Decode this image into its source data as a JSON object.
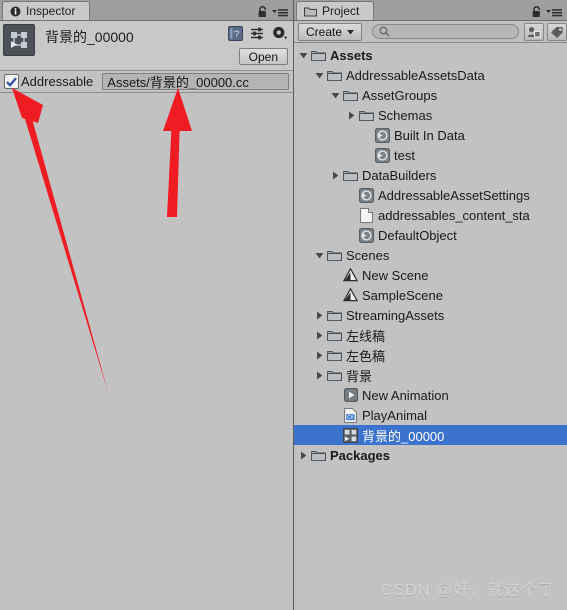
{
  "inspector": {
    "tab_label": "Inspector",
    "tab_icon": "info-icon",
    "lock_icon": "lock-icon",
    "menu_icon": "hamburger-menu-icon",
    "asset_icon": "animator-controller-icon",
    "asset_name": "背景的_00000",
    "help_icon": "help-book-icon",
    "preset_icon": "preset-sliders-icon",
    "settings_icon": "gear-icon",
    "open_button": "Open",
    "addressable": {
      "checked": true,
      "checkbox_icon": "checkmark-icon",
      "label": "Addressable",
      "address_value": "Assets/背景的_00000.cc",
      "address_placeholder": "Address"
    }
  },
  "project": {
    "tab_label": "Project",
    "tab_icon": "folder-icon",
    "lock_icon": "lock-icon",
    "menu_icon": "hamburger-menu-icon",
    "toolbar": {
      "create_label": "Create",
      "create_caret_icon": "chevron-down-icon",
      "search_icon": "search-icon",
      "search_value": "",
      "search_placeholder": "",
      "filter_type_icon": "filter-by-type-icon",
      "filter_label_icon": "filter-by-label-icon"
    },
    "tree": [
      {
        "label": "Assets",
        "depth": 0,
        "icon": "folder-icon",
        "toggle": "expanded",
        "bold": true,
        "selected": false
      },
      {
        "label": "AddressableAssetsData",
        "depth": 1,
        "icon": "folder-icon",
        "toggle": "expanded",
        "bold": false,
        "selected": false
      },
      {
        "label": "AssetGroups",
        "depth": 2,
        "icon": "folder-icon",
        "toggle": "expanded",
        "bold": false,
        "selected": false
      },
      {
        "label": "Schemas",
        "depth": 3,
        "icon": "folder-icon",
        "toggle": "collapsed",
        "bold": false,
        "selected": false
      },
      {
        "label": "Built In Data",
        "depth": 4,
        "icon": "scriptable-object-icon",
        "toggle": "none",
        "bold": false,
        "selected": false
      },
      {
        "label": "test",
        "depth": 4,
        "icon": "scriptable-object-icon",
        "toggle": "none",
        "bold": false,
        "selected": false
      },
      {
        "label": "DataBuilders",
        "depth": 2,
        "icon": "folder-icon",
        "toggle": "collapsed",
        "bold": false,
        "selected": false
      },
      {
        "label": "AddressableAssetSettings",
        "depth": 3,
        "icon": "scriptable-object-icon",
        "toggle": "none",
        "bold": false,
        "selected": false
      },
      {
        "label": "addressables_content_sta",
        "depth": 3,
        "icon": "text-file-icon",
        "toggle": "none",
        "bold": false,
        "selected": false
      },
      {
        "label": "DefaultObject",
        "depth": 3,
        "icon": "scriptable-object-icon",
        "toggle": "none",
        "bold": false,
        "selected": false
      },
      {
        "label": "Scenes",
        "depth": 1,
        "icon": "folder-icon",
        "toggle": "expanded",
        "bold": false,
        "selected": false
      },
      {
        "label": "New Scene",
        "depth": 2,
        "icon": "scene-icon",
        "toggle": "none",
        "bold": false,
        "selected": false
      },
      {
        "label": "SampleScene",
        "depth": 2,
        "icon": "scene-icon",
        "toggle": "none",
        "bold": false,
        "selected": false
      },
      {
        "label": "StreamingAssets",
        "depth": 1,
        "icon": "folder-icon",
        "toggle": "collapsed",
        "bold": false,
        "selected": false
      },
      {
        "label": "左线稿",
        "depth": 1,
        "icon": "folder-icon",
        "toggle": "collapsed",
        "bold": false,
        "selected": false
      },
      {
        "label": "左色稿",
        "depth": 1,
        "icon": "folder-icon",
        "toggle": "collapsed",
        "bold": false,
        "selected": false
      },
      {
        "label": "背景",
        "depth": 1,
        "icon": "folder-icon",
        "toggle": "collapsed",
        "bold": false,
        "selected": false
      },
      {
        "label": "New Animation",
        "depth": 2,
        "icon": "animation-clip-icon",
        "toggle": "none",
        "bold": false,
        "selected": false
      },
      {
        "label": "PlayAnimal",
        "depth": 2,
        "icon": "script-icon",
        "toggle": "none",
        "bold": false,
        "selected": false
      },
      {
        "label": "背景的_00000",
        "depth": 2,
        "icon": "animator-controller-icon",
        "toggle": "none",
        "bold": false,
        "selected": true
      },
      {
        "label": "Packages",
        "depth": 0,
        "icon": "folder-icon",
        "toggle": "collapsed",
        "bold": true,
        "selected": false
      }
    ]
  },
  "annotations": {
    "arrow_color": "#ef1c24",
    "arrow_left_name": "arrow-pointing-to-addressable-checkbox",
    "arrow_right_name": "arrow-pointing-to-address-field"
  },
  "watermark": {
    "text": "CSDN @好，就这个了"
  },
  "colors": {
    "panel_bg": "#c2c2c2",
    "selection_blue": "#3a72ce",
    "tab_bg": "#c9c9c9",
    "tabbar_bg": "#9e9e9e",
    "arrow_red": "#ef1c24"
  }
}
